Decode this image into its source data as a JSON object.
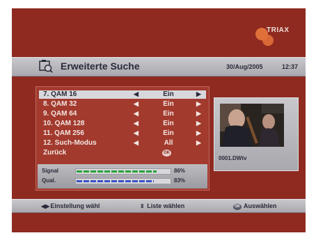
{
  "brand": {
    "logo_text": "TRIAX"
  },
  "header": {
    "title": "Erweiterte Suche",
    "date": "30/Aug/2005",
    "time": "12:37"
  },
  "menu": {
    "items": [
      {
        "label": "7. QAM 16",
        "value": "Ein",
        "selected": true
      },
      {
        "label": "8. QAM 32",
        "value": "Ein"
      },
      {
        "label": "9. QAM 64",
        "value": "Ein"
      },
      {
        "label": "10. QAM 128",
        "value": "Ein"
      },
      {
        "label": "11. QAM 256",
        "value": "Ein"
      },
      {
        "label": "12. Such-Modus",
        "value": "All"
      }
    ],
    "back_label": "Zurück",
    "ok_text": "OK"
  },
  "signal": {
    "label": "Signal",
    "percent_text": "86%",
    "percent": 86,
    "color": "#28a23a"
  },
  "quality": {
    "label": "Qual.",
    "percent_text": "83%",
    "percent": 83,
    "color": "#3a52c8"
  },
  "preview": {
    "channel": "0001.DWtv"
  },
  "footer": {
    "hint1": "Einstellung wähl",
    "hint2": "Liste wählen",
    "hint3": "Auswählen",
    "ok_text": "OK"
  },
  "colors": {
    "background": "#8e2a20",
    "panel": "#a33a2e",
    "bar": "#c8c8cc"
  }
}
